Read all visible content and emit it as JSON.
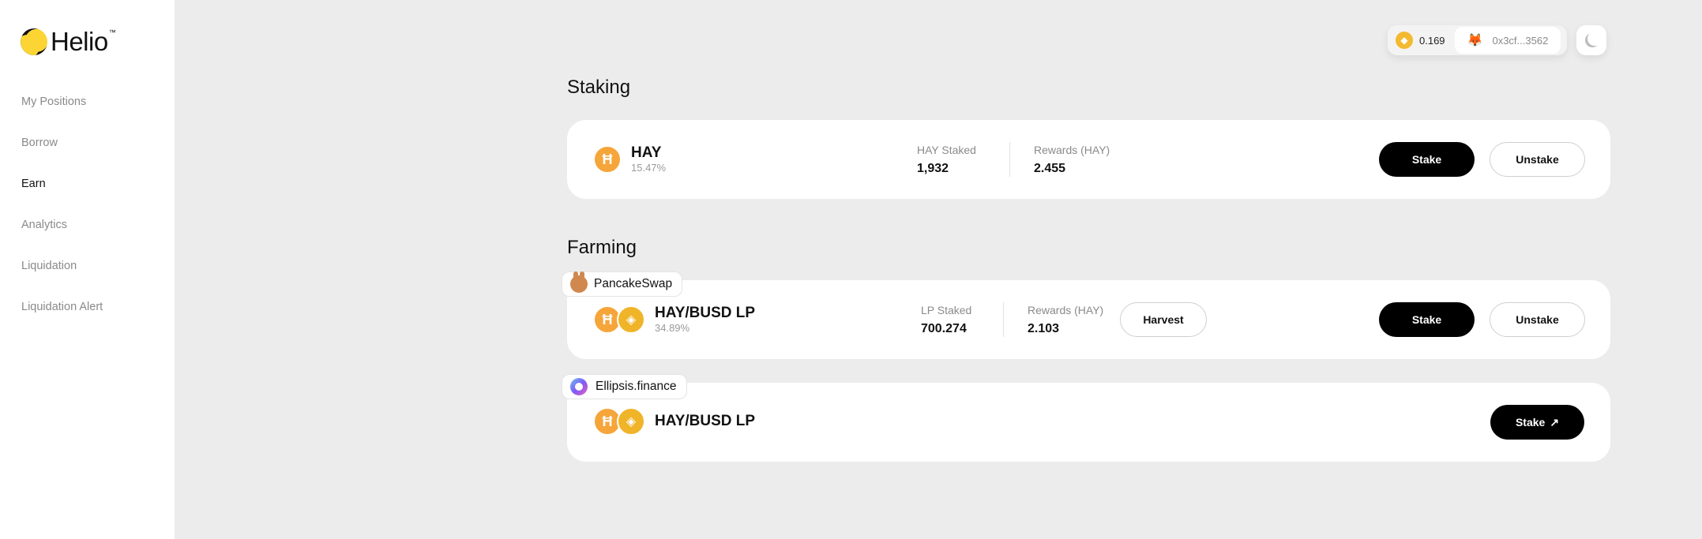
{
  "sidebar": {
    "logo_text": "Helio",
    "logo_tm": "™",
    "items": [
      {
        "label": "My Positions"
      },
      {
        "label": "Borrow"
      },
      {
        "label": "Earn"
      },
      {
        "label": "Analytics"
      },
      {
        "label": "Liquidation"
      },
      {
        "label": "Liquidation Alert"
      }
    ],
    "active_item": "Earn"
  },
  "topbar": {
    "balance": "0.169",
    "wallet_address": "0x3cf...3562"
  },
  "staking": {
    "title": "Staking",
    "token_name": "HAY",
    "apr": "15.47%",
    "staked_label": "HAY Staked",
    "staked_value": "1,932",
    "rewards_label": "Rewards (HAY)",
    "rewards_value": "2.455",
    "stake_label": "Stake",
    "unstake_label": "Unstake"
  },
  "farming": {
    "title": "Farming",
    "pancake": {
      "source": "PancakeSwap",
      "token_name": "HAY/BUSD LP",
      "apr": "34.89%",
      "staked_label": "LP Staked",
      "staked_value": "700.274",
      "rewards_label": "Rewards (HAY)",
      "rewards_value": "2.103",
      "harvest_label": "Harvest",
      "stake_label": "Stake",
      "unstake_label": "Unstake"
    },
    "ellipsis": {
      "source": "Ellipsis.finance",
      "token_name": "HAY/BUSD LP",
      "stake_label": "Stake"
    }
  },
  "colors": {
    "accent": "#fcd535",
    "background": "#ececec",
    "card": "#ffffff",
    "button_dark": "#000000"
  }
}
